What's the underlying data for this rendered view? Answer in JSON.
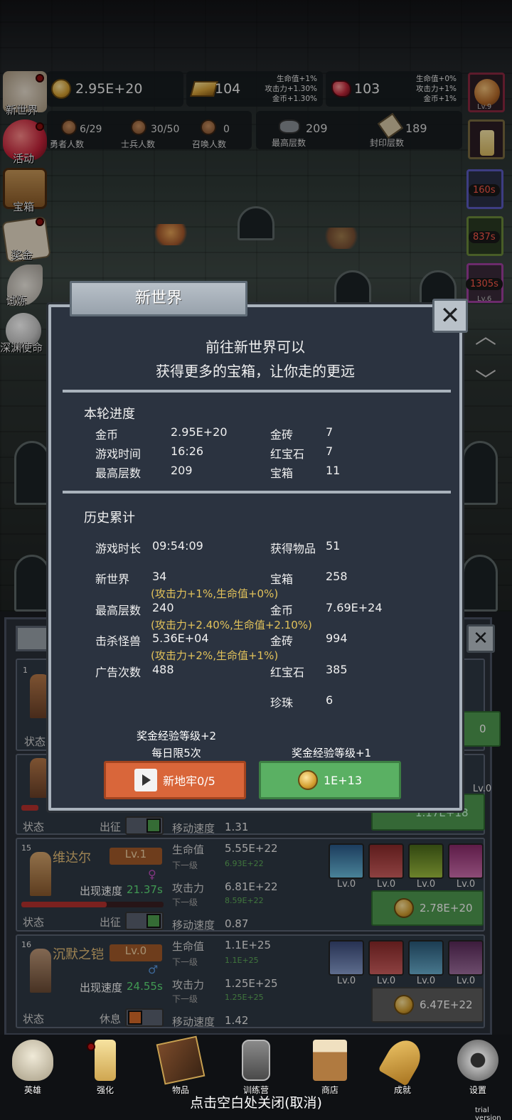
{
  "resources": {
    "gold": "2.95E+20",
    "gold_bar": "104",
    "gold_bar_bonus": [
      "生命值+1%",
      "攻击力+1.30%",
      "金币+1.30%"
    ],
    "ruby": "103",
    "ruby_bonus": [
      "生命值+0%",
      "攻击力+1%",
      "金币+1%"
    ]
  },
  "counts": [
    {
      "value": "6/29",
      "label": "勇者人数"
    },
    {
      "value": "30/50",
      "label": "士兵人数"
    },
    {
      "value": "0",
      "label": "召唤人数"
    },
    {
      "value": "209",
      "label": "最高层数"
    },
    {
      "value": "189",
      "label": "封印层数"
    }
  ],
  "side_menu": [
    "新世界",
    "活动",
    "宝箱",
    "奖金",
    "试炼",
    "深渊使命"
  ],
  "right_side": {
    "top_lv": "Lv.9",
    "timers": [
      "160s",
      "837s",
      "1305s"
    ],
    "bottom_lv": "Lv.6"
  },
  "modal": {
    "title": "新世界",
    "intro": [
      "前往新世界可以",
      "获得更多的宝箱，让你走的更远"
    ],
    "section1": "本轮进度",
    "current": [
      {
        "k1": "金币",
        "v1": "2.95E+20",
        "k2": "金砖",
        "v2": "7"
      },
      {
        "k1": "游戏时间",
        "v1": "16:26",
        "k2": "红宝石",
        "v2": "7"
      },
      {
        "k1": "最高层数",
        "v1": "209",
        "k2": "宝箱",
        "v2": "11"
      }
    ],
    "section2": "历史累计",
    "history": {
      "play_time_label": "游戏时长",
      "play_time": "09:54:09",
      "items_label": "获得物品",
      "items": "51",
      "new_world_label": "新世界",
      "new_world": "34",
      "new_world_bonus": "(攻击力+1%,生命值+0%)",
      "chest_label": "宝箱",
      "chest": "258",
      "max_floor_label": "最高层数",
      "max_floor": "240",
      "max_floor_bonus": "(攻击力+2.40%,生命值+2.10%)",
      "gold_label": "金币",
      "gold": "7.69E+24",
      "kills_label": "击杀怪兽",
      "kills": "5.36E+04",
      "kills_bonus": "(攻击力+2%,生命值+1%)",
      "gold_bar_label": "金砖",
      "gold_bar": "994",
      "ads_label": "广告次数",
      "ads": "488",
      "ruby_label": "红宝石",
      "ruby": "385",
      "pearl_label": "珍珠",
      "pearl": "6"
    },
    "left_note": [
      "奖金经验等级+2",
      "每日限5次"
    ],
    "right_note": "奖金经验等级+1",
    "left_button": "新地牢0/5",
    "right_button": "1E+13"
  },
  "heroes": {
    "card1": {
      "num": "1",
      "status": "状态",
      "value_right": "0"
    },
    "card2": {
      "status": "状态",
      "action": "出征",
      "move_label": "移动速度",
      "move": "1.31",
      "skills_lv": "Lv.0",
      "cost": "1.17E+18"
    },
    "card3": {
      "num": "15",
      "name": "维达尔",
      "lv": "Lv.1",
      "speed_label": "出现速度",
      "speed": "21.37s",
      "hp_label": "生命值",
      "hp": "5.55E+22",
      "next_label": "下一级",
      "hp_next": "6.93E+22",
      "atk_label": "攻击力",
      "atk": "6.81E+22",
      "atk_next": "8.59E+22",
      "move_label": "移动速度",
      "move": "0.87",
      "status": "状态",
      "action": "出征",
      "skills_lv": [
        "Lv.0",
        "Lv.0",
        "Lv.0",
        "Lv.0"
      ],
      "cost": "2.78E+20"
    },
    "card4": {
      "num": "16",
      "name": "沉默之铠",
      "lv": "Lv.0",
      "speed_label": "出现速度",
      "speed": "24.55s",
      "hp_label": "生命值",
      "hp": "1.1E+25",
      "next_label": "下一级",
      "hp_next": "1.1E+25",
      "atk_label": "攻击力",
      "atk": "1.25E+25",
      "atk_next": "1.25E+25",
      "move_label": "移动速度",
      "move": "1.42",
      "status": "状态",
      "action": "休息",
      "skills_lv": [
        "Lv.0",
        "Lv.0",
        "Lv.0",
        "Lv.0"
      ],
      "cost": "6.47E+22"
    }
  },
  "nav": [
    "英雄",
    "强化",
    "物品",
    "训练营",
    "商店",
    "成就",
    "设置"
  ],
  "close_hint": "点击空白处关闭(取消)",
  "trial": "trial version"
}
